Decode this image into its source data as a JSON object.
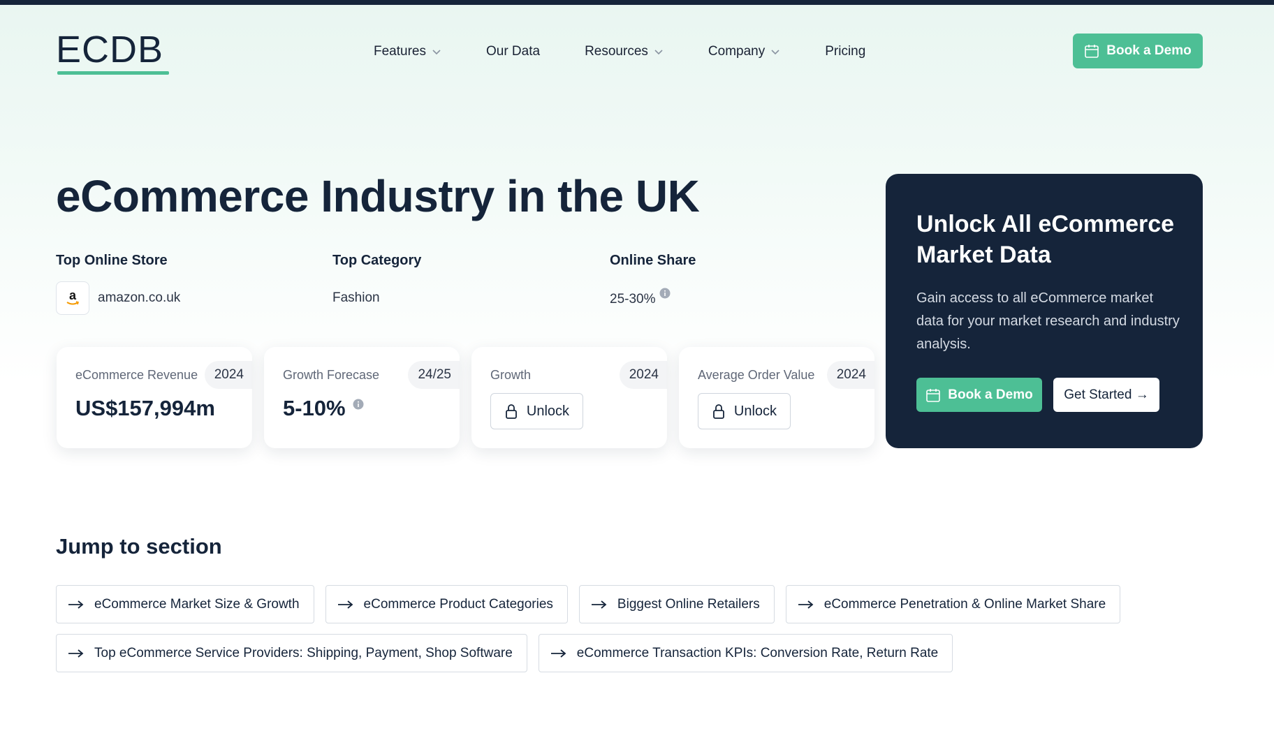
{
  "header": {
    "logo_text": "ECDB",
    "nav": [
      {
        "label": "Features",
        "has_dropdown": true
      },
      {
        "label": "Our Data",
        "has_dropdown": false
      },
      {
        "label": "Resources",
        "has_dropdown": true
      },
      {
        "label": "Company",
        "has_dropdown": true
      },
      {
        "label": "Pricing",
        "has_dropdown": false
      }
    ],
    "cta_label": "Book a Demo"
  },
  "hero": {
    "title": "eCommerce Industry in the UK",
    "top_store": {
      "label": "Top Online Store",
      "value": "amazon.co.uk",
      "logo_letter": "a"
    },
    "top_category": {
      "label": "Top Category",
      "value": "Fashion"
    },
    "online_share": {
      "label": "Online Share",
      "value": "25-30%"
    }
  },
  "cards": [
    {
      "label": "eCommerce Revenue",
      "year": "2024",
      "value": "US$157,994m",
      "locked": false
    },
    {
      "label": "Growth Forecase",
      "year": "24/25",
      "value": "5-10%",
      "locked": false
    },
    {
      "label": "Growth",
      "year": "2024",
      "unlock_label": "Unlock",
      "locked": true
    },
    {
      "label": "Average Order Value",
      "year": "2024",
      "unlock_label": "Unlock",
      "locked": true
    }
  ],
  "panel": {
    "title": "Unlock All eCommerce Market Data",
    "description": "Gain access to all eCommerce market data for your market research and industry analysis.",
    "demo_label": "Book a Demo",
    "started_label": "Get Started →"
  },
  "jump": {
    "title": "Jump to section",
    "links": [
      "eCommerce Market Size & Growth",
      "eCommerce Product Categories",
      "Biggest Online Retailers",
      "eCommerce Penetration & Online Market Share",
      "Top eCommerce Service Providers: Shipping, Payment, Shop Software",
      "eCommerce Transaction KPIs: Conversion Rate, Return Rate"
    ]
  },
  "colors": {
    "brand_dark": "#15243a",
    "accent_green": "#4dbf95"
  }
}
